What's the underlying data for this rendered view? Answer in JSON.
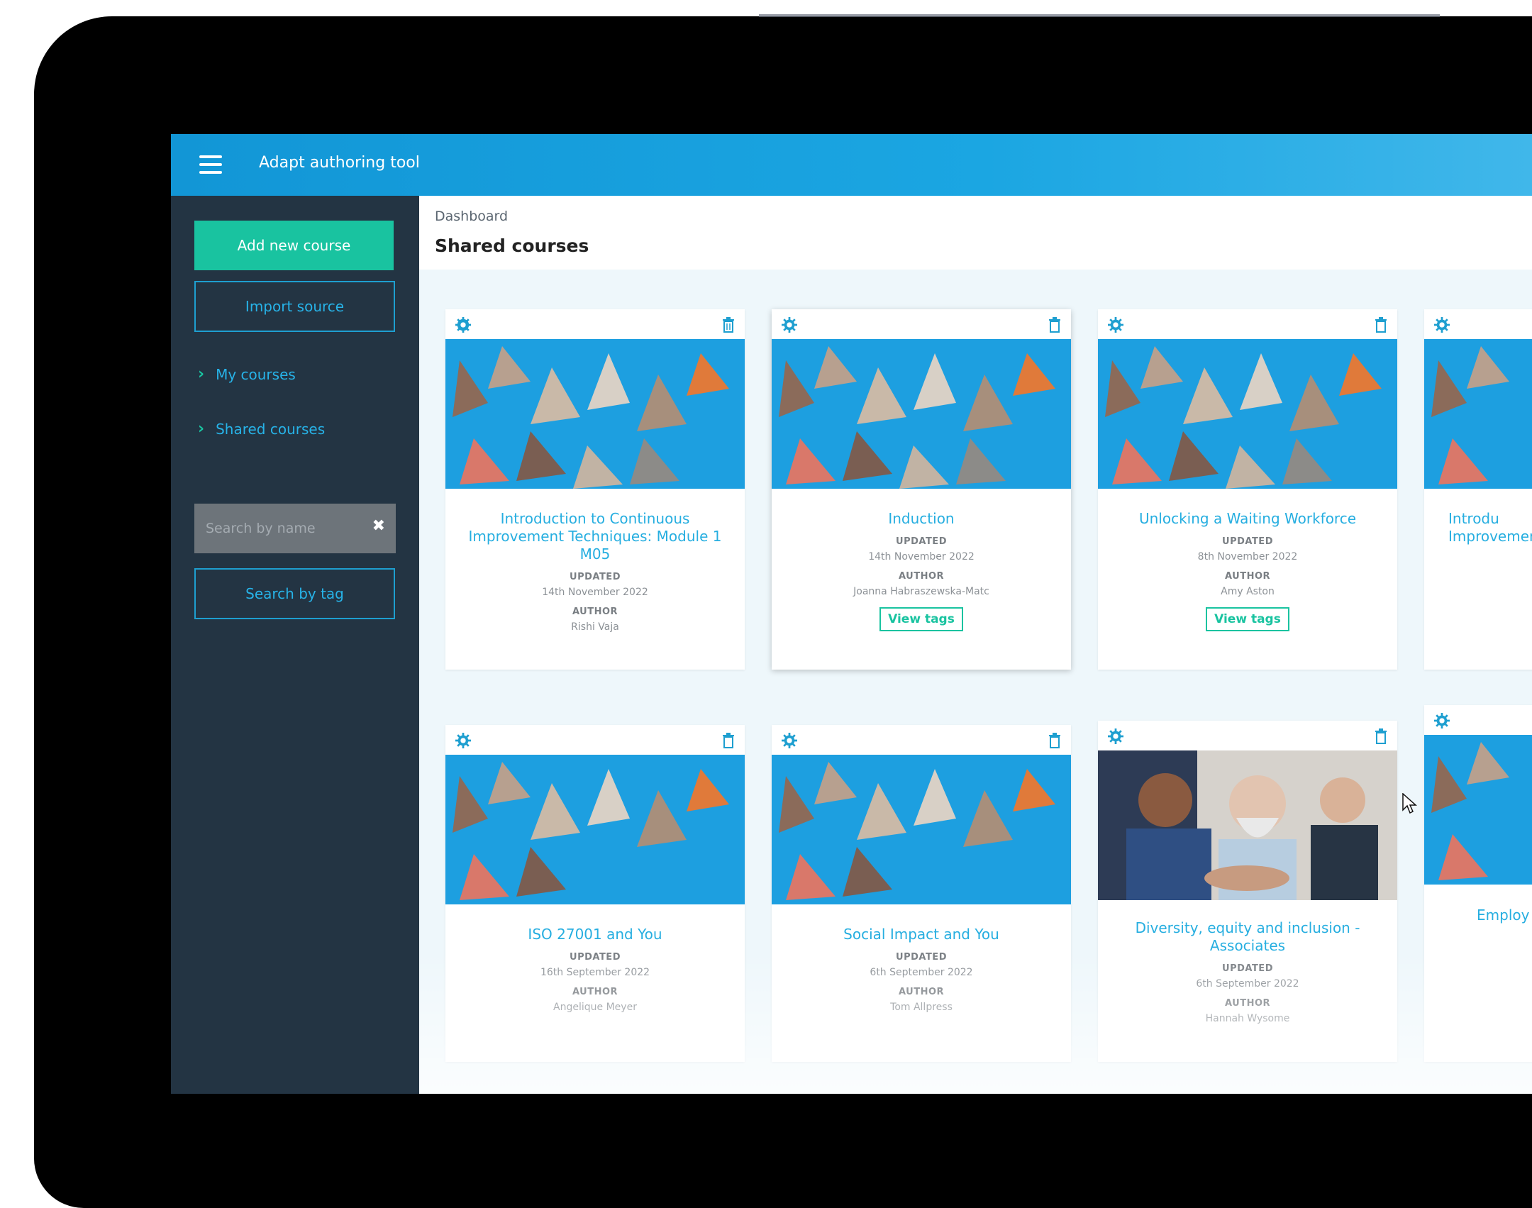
{
  "app": {
    "title": "Adapt authoring tool"
  },
  "sidebar": {
    "add_new_course": "Add new course",
    "import_source": "Import source",
    "nav": [
      {
        "label": "My courses"
      },
      {
        "label": "Shared courses"
      }
    ],
    "search_placeholder": "Search by name",
    "search_by_tag": "Search by tag"
  },
  "header": {
    "breadcrumb": "Dashboard",
    "title": "Shared courses"
  },
  "labels": {
    "updated": "UPDATED",
    "author": "AUTHOR",
    "view_tags": "View tags"
  },
  "courses": [
    {
      "title": "Introduction to Continuous Improvement Techniques: Module 1 M05",
      "updated": "14th November 2022",
      "author": "Rishi Vaja",
      "image": "origami-cranes"
    },
    {
      "title": "Induction",
      "updated": "14th November 2022",
      "author": "Joanna Habraszewska-Matc",
      "image": "origami-cranes"
    },
    {
      "title": "Unlocking a Waiting Workforce",
      "updated": "8th November 2022",
      "author": "Amy Aston",
      "image": "origami-cranes"
    },
    {
      "title": "Introdu Improvemen",
      "image": "origami-cranes"
    },
    {
      "title": "ISO 27001 and You",
      "updated": "16th September 2022",
      "author": "Angelique Meyer",
      "image": "origami-cranes"
    },
    {
      "title": "Social Impact and You",
      "updated": "6th September 2022",
      "author": "Tom Allpress",
      "image": "origami-cranes"
    },
    {
      "title": "Diversity, equity and inclusion - Associates",
      "updated": "6th September 2022",
      "author": "Hannah Wysome",
      "image": "business-meeting-photo"
    },
    {
      "title": "Employ",
      "image": "origami-cranes"
    }
  ],
  "colors": {
    "topbar": "#1296d6",
    "sidebar": "#233443",
    "accent_green": "#19c3a0",
    "link_blue": "#27b3e8"
  }
}
